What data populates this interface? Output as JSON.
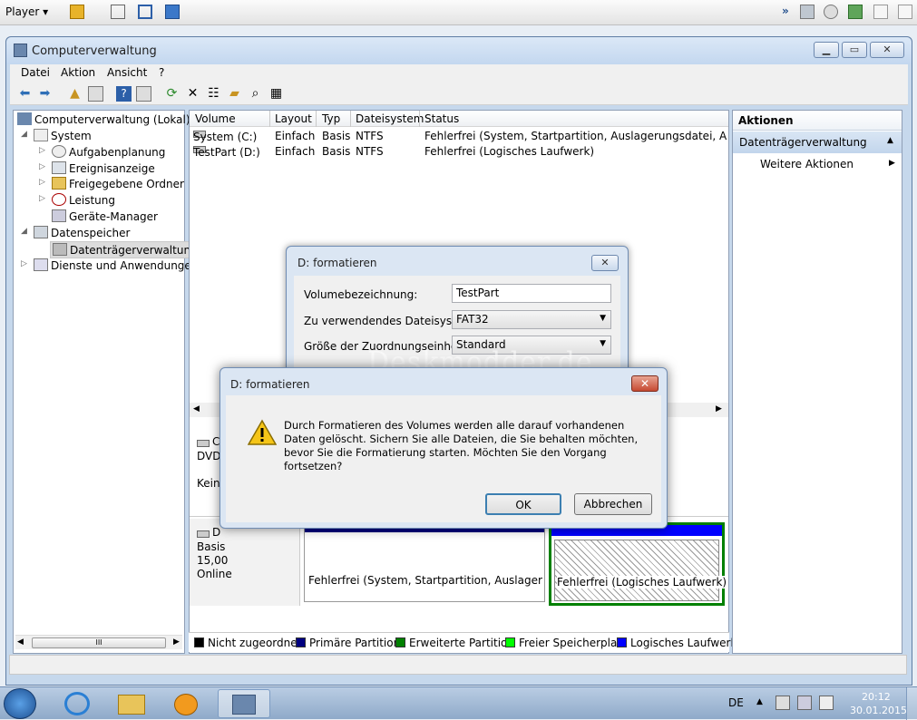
{
  "player": {
    "label": "Player"
  },
  "window": {
    "title": "Computerverwaltung",
    "menu": [
      "Datei",
      "Aktion",
      "Ansicht",
      "?"
    ]
  },
  "tree": {
    "root": "Computerverwaltung (Lokal)",
    "system": "System",
    "items": [
      "Aufgabenplanung",
      "Ereignisanzeige",
      "Freigegebene Ordner",
      "Leistung",
      "Geräte-Manager"
    ],
    "storage": "Datenspeicher",
    "disk_mgmt": "Datenträgerverwaltung",
    "services": "Dienste und Anwendungen",
    "scroll_label": "III"
  },
  "volumes": {
    "headers": [
      "Volume",
      "Layout",
      "Typ",
      "Dateisystem",
      "Status"
    ],
    "rows": [
      [
        "System (C:)",
        "Einfach",
        "Basis",
        "NTFS",
        "Fehlerfrei (System, Startpartition, Auslagerungsdatei, Aktiv, Abst"
      ],
      [
        "TestPart (D:)",
        "Einfach",
        "Basis",
        "NTFS",
        "Fehlerfrei (Logisches Laufwerk)"
      ]
    ]
  },
  "disks": {
    "disk0_prefix": "C",
    "disk0_type": "DVD",
    "disk0_media": "Kein",
    "disk1_prefix": "D",
    "disk1_type": "Basis",
    "disk1_size": "15,00",
    "disk1_state": "Online",
    "part_c_status": "Fehlerfrei (System, Startpartition, Auslagerungsd",
    "part_d_status": "Fehlerfrei (Logisches Laufwerk)"
  },
  "legend": {
    "items": [
      {
        "label": "Nicht zugeordnet",
        "color": "#000000"
      },
      {
        "label": "Primäre Partition",
        "color": "#000080"
      },
      {
        "label": "Erweiterte Partition",
        "color": "#008000"
      },
      {
        "label": "Freier Speicherplatz",
        "color": "#00ff00"
      },
      {
        "label": "Logisches Laufwerk",
        "color": "#0000ff"
      }
    ]
  },
  "actions": {
    "header": "Aktionen",
    "section": "Datenträgerverwaltung",
    "more": "Weitere Aktionen"
  },
  "format_dialog": {
    "title": "D: formatieren",
    "volume_label": "Volumebezeichnung:",
    "volume_value": "TestPart",
    "fs_label": "Zu verwendendes Dateisystem:",
    "fs_value": "FAT32",
    "unit_label": "Größe der Zuordnungseinheit:",
    "unit_value": "Standard"
  },
  "confirm_dialog": {
    "title": "D: formatieren",
    "message": "Durch Formatieren des Volumes werden alle darauf vorhandenen Daten gelöscht. Sichern Sie alle Dateien, die Sie behalten möchten, bevor Sie die Formatierung starten. Möchten Sie den Vorgang fortsetzen?",
    "ok": "OK",
    "cancel": "Abbrechen"
  },
  "watermark": "Deskmodder.de",
  "taskbar": {
    "language": "DE",
    "time": "20:12",
    "date": "30.01.2015"
  }
}
